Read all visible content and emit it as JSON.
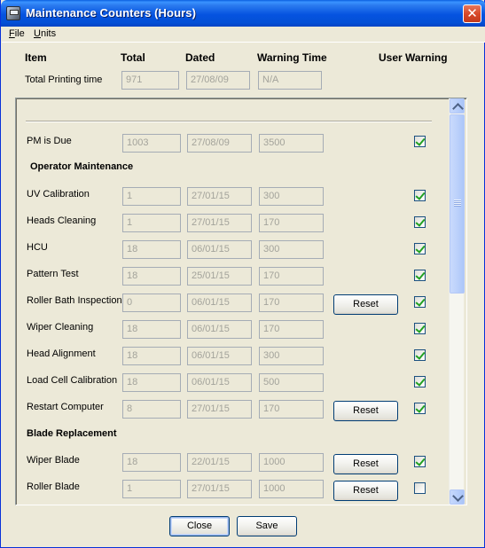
{
  "window": {
    "title": "Maintenance Counters (Hours)",
    "close_glyph": "✕"
  },
  "menu": {
    "file": {
      "mn": "F",
      "rest": "ile"
    },
    "units": {
      "mn": "U",
      "rest": "nits"
    }
  },
  "columns": {
    "item": "Item",
    "total": "Total",
    "dated": "Dated",
    "warning_time": "Warning Time",
    "user_warning": "User Warning"
  },
  "total_printing": {
    "label": "Total Printing time",
    "total": "971",
    "dated": "27/08/09",
    "warning": "N/A"
  },
  "pm_due": {
    "label": "PM is Due",
    "total": "1003",
    "dated": "27/08/09",
    "warning": "3500",
    "user_warning": true
  },
  "sections": {
    "operator": "Operator Maintenance",
    "blade": "Blade Replacement"
  },
  "rows": [
    {
      "label": "UV Calibration",
      "total": "1",
      "dated": "27/01/15",
      "warning": "300",
      "user_warning": true,
      "reset": ""
    },
    {
      "label": "Heads Cleaning",
      "total": "1",
      "dated": "27/01/15",
      "warning": "170",
      "user_warning": true,
      "reset": ""
    },
    {
      "label": "HCU",
      "total": "18",
      "dated": "06/01/15",
      "warning": "300",
      "user_warning": true,
      "reset": ""
    },
    {
      "label": "Pattern Test",
      "total": "18",
      "dated": "25/01/15",
      "warning": "170",
      "user_warning": true,
      "reset": ""
    },
    {
      "label": "Roller Bath Inspection",
      "total": "0",
      "dated": "06/01/15",
      "warning": "170",
      "user_warning": true,
      "reset": "Reset"
    },
    {
      "label": "Wiper Cleaning",
      "total": "18",
      "dated": "06/01/15",
      "warning": "170",
      "user_warning": true,
      "reset": ""
    },
    {
      "label": "Head Alignment",
      "total": "18",
      "dated": "06/01/15",
      "warning": "300",
      "user_warning": true,
      "reset": ""
    },
    {
      "label": "Load Cell Calibration",
      "total": "18",
      "dated": "06/01/15",
      "warning": "500",
      "user_warning": true,
      "reset": ""
    },
    {
      "label": "Restart Computer",
      "total": "8",
      "dated": "27/01/15",
      "warning": "170",
      "user_warning": true,
      "reset": "Reset"
    },
    {
      "label": "Wiper Blade",
      "total": "18",
      "dated": "22/01/15",
      "warning": "1000",
      "user_warning": true,
      "reset": "Reset"
    },
    {
      "label": "Roller Blade",
      "total": "1",
      "dated": "27/01/15",
      "warning": "1000",
      "user_warning": false,
      "reset": "Reset"
    }
  ],
  "buttons": {
    "close": "Close",
    "save": "Save"
  }
}
